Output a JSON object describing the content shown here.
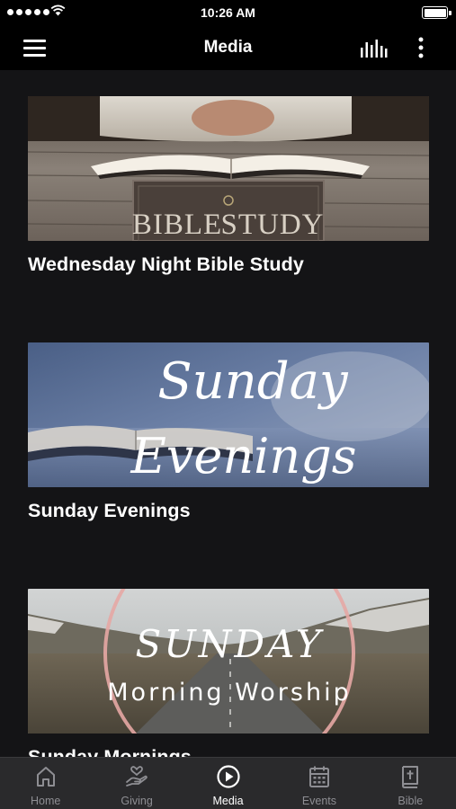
{
  "status_bar": {
    "time": "10:26 AM"
  },
  "nav": {
    "title": "Media"
  },
  "media": [
    {
      "title": "Wednesday Night Bible Study",
      "image_text": [
        "BIBLE",
        "STUDY"
      ]
    },
    {
      "title": "Sunday Evenings",
      "image_text": [
        "Sunday",
        "Evenings"
      ]
    },
    {
      "title": "Sunday Mornings",
      "image_text": [
        "SUNDAY",
        "Morning Worship"
      ]
    }
  ],
  "tabs": [
    {
      "label": "Home",
      "icon": "home-icon"
    },
    {
      "label": "Giving",
      "icon": "giving-hand-icon"
    },
    {
      "label": "Media",
      "icon": "play-circle-icon",
      "active": true
    },
    {
      "label": "Events",
      "icon": "calendar-icon"
    },
    {
      "label": "Bible",
      "icon": "bible-icon"
    }
  ],
  "colors": {
    "background": "#141416",
    "bar": "#000000",
    "tab_bar": "#2a2a2c",
    "tab_inactive": "#8e8e93",
    "tab_active": "#ffffff"
  }
}
